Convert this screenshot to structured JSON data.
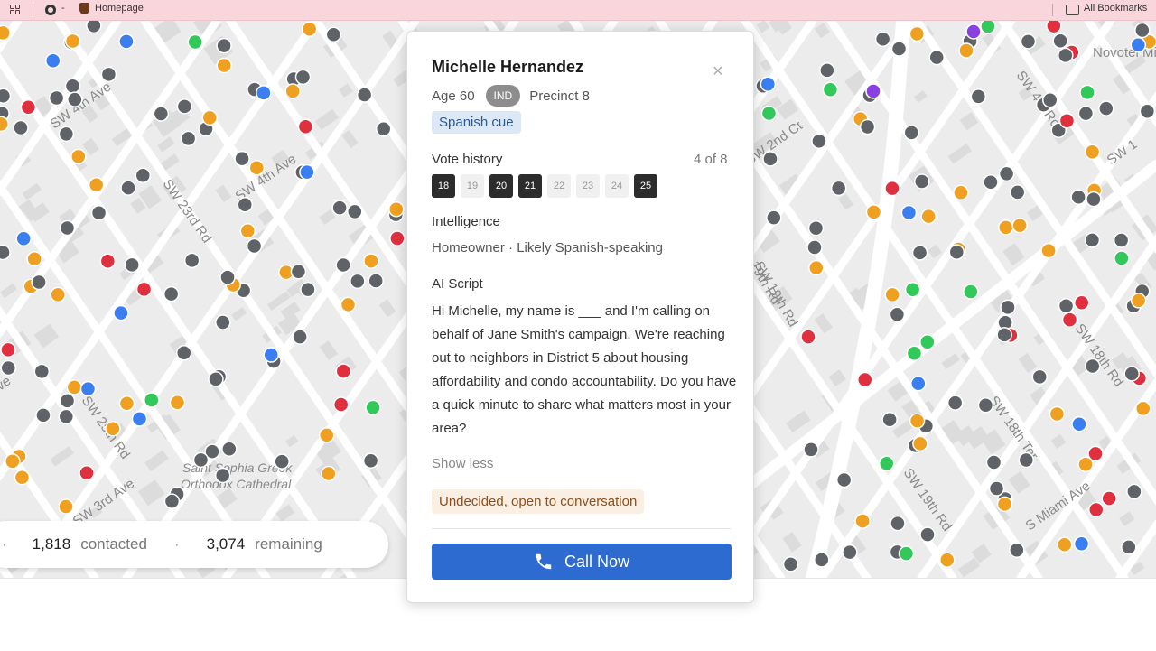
{
  "bookmarks": {
    "separator": "-",
    "homepage_label": "Homepage",
    "all_bookmarks_label": "All Bookmarks"
  },
  "map": {
    "street_labels": [
      "SW 4th Ave",
      "SW 23rd Rd",
      "SW 25th Rd",
      "SW 3rd Ave",
      "SW 2nd Ct",
      "SW 19th Rd",
      "SW 18th Rd",
      "SW 18th Ter",
      "SW 19th Rd",
      "S Miami Ave",
      "Novotel Mi",
      "SW 1",
      "SW 4th Ave",
      "SW 4th Rd",
      "ve",
      "19th Rd"
    ],
    "poi_label_line1": "Saint Sophia Greek",
    "poi_label_line2": "Orthodox Cathedral",
    "marker_colors": {
      "neutral": "#5f6368",
      "red": "#e0303f",
      "orange": "#f0a020",
      "green": "#32c85a",
      "blue": "#3a7ef0",
      "purple": "#8a3fe0"
    }
  },
  "stats": {
    "contacted_count": "1,818",
    "contacted_label": "contacted",
    "remaining_count": "3,074",
    "remaining_label": "remaining",
    "dot": "·"
  },
  "voter": {
    "name": "Michelle Hernandez",
    "age": "Age 60",
    "party": "IND",
    "precinct": "Precinct 8",
    "cue": "Spanish cue",
    "vote_history_title": "Vote history",
    "vote_history_count": "4 of 8",
    "years": [
      {
        "label": "18",
        "voted": true
      },
      {
        "label": "19",
        "voted": false
      },
      {
        "label": "20",
        "voted": true
      },
      {
        "label": "21",
        "voted": true
      },
      {
        "label": "22",
        "voted": false
      },
      {
        "label": "23",
        "voted": false
      },
      {
        "label": "24",
        "voted": false
      },
      {
        "label": "25",
        "voted": true
      }
    ],
    "intelligence_title": "Intelligence",
    "intelligence_text": "Homeowner · Likely Spanish-speaking",
    "script_title": "AI Script",
    "script_text": "Hi Michelle, my name is ___ and I'm calling on behalf of Jane Smith's campaign. We're reaching out to neighbors in District 5 about housing affordability and condo accountability. Do you have a quick minute to share what matters most in your area?",
    "show_less": "Show less",
    "sentiment": "Undecided, open to conversation",
    "call_button": "Call Now",
    "close_symbol": "×"
  },
  "colors": {
    "call_button": "#2d6bd0",
    "cue_bg": "#dce8f5",
    "sentiment_bg": "#fbeee3"
  }
}
